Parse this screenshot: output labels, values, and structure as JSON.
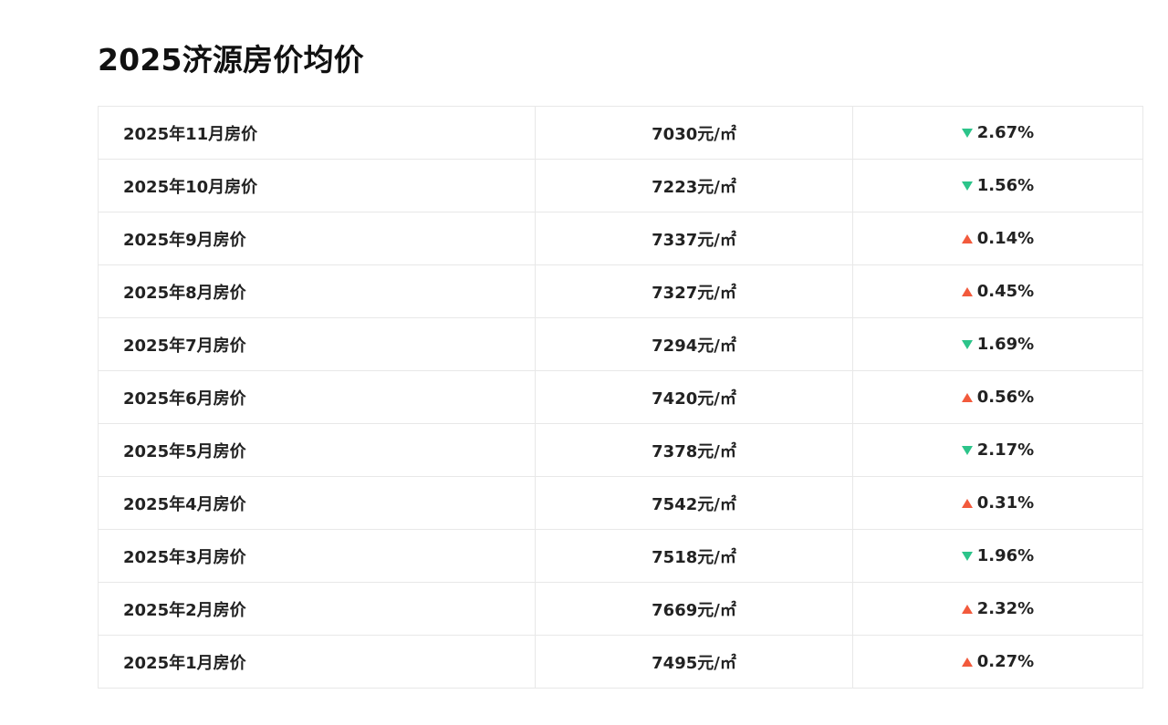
{
  "page": {
    "title": "2025济源房价均价"
  },
  "colors": {
    "down": "#2cc48a",
    "up": "#f25a3c",
    "border": "#e8e8e8"
  },
  "rows": [
    {
      "month": "2025年11月房价",
      "price": "7030元/㎡",
      "direction": "down",
      "icon": "triangle-down-icon",
      "change": "2.67%"
    },
    {
      "month": "2025年10月房价",
      "price": "7223元/㎡",
      "direction": "down",
      "icon": "triangle-down-icon",
      "change": "1.56%"
    },
    {
      "month": "2025年9月房价",
      "price": "7337元/㎡",
      "direction": "up",
      "icon": "triangle-up-icon",
      "change": "0.14%"
    },
    {
      "month": "2025年8月房价",
      "price": "7327元/㎡",
      "direction": "up",
      "icon": "triangle-up-icon",
      "change": "0.45%"
    },
    {
      "month": "2025年7月房价",
      "price": "7294元/㎡",
      "direction": "down",
      "icon": "triangle-down-icon",
      "change": "1.69%"
    },
    {
      "month": "2025年6月房价",
      "price": "7420元/㎡",
      "direction": "up",
      "icon": "triangle-up-icon",
      "change": "0.56%"
    },
    {
      "month": "2025年5月房价",
      "price": "7378元/㎡",
      "direction": "down",
      "icon": "triangle-down-icon",
      "change": "2.17%"
    },
    {
      "month": "2025年4月房价",
      "price": "7542元/㎡",
      "direction": "up",
      "icon": "triangle-up-icon",
      "change": "0.31%"
    },
    {
      "month": "2025年3月房价",
      "price": "7518元/㎡",
      "direction": "down",
      "icon": "triangle-down-icon",
      "change": "1.96%"
    },
    {
      "month": "2025年2月房价",
      "price": "7669元/㎡",
      "direction": "up",
      "icon": "triangle-up-icon",
      "change": "2.32%"
    },
    {
      "month": "2025年1月房价",
      "price": "7495元/㎡",
      "direction": "up",
      "icon": "triangle-up-icon",
      "change": "0.27%"
    }
  ]
}
